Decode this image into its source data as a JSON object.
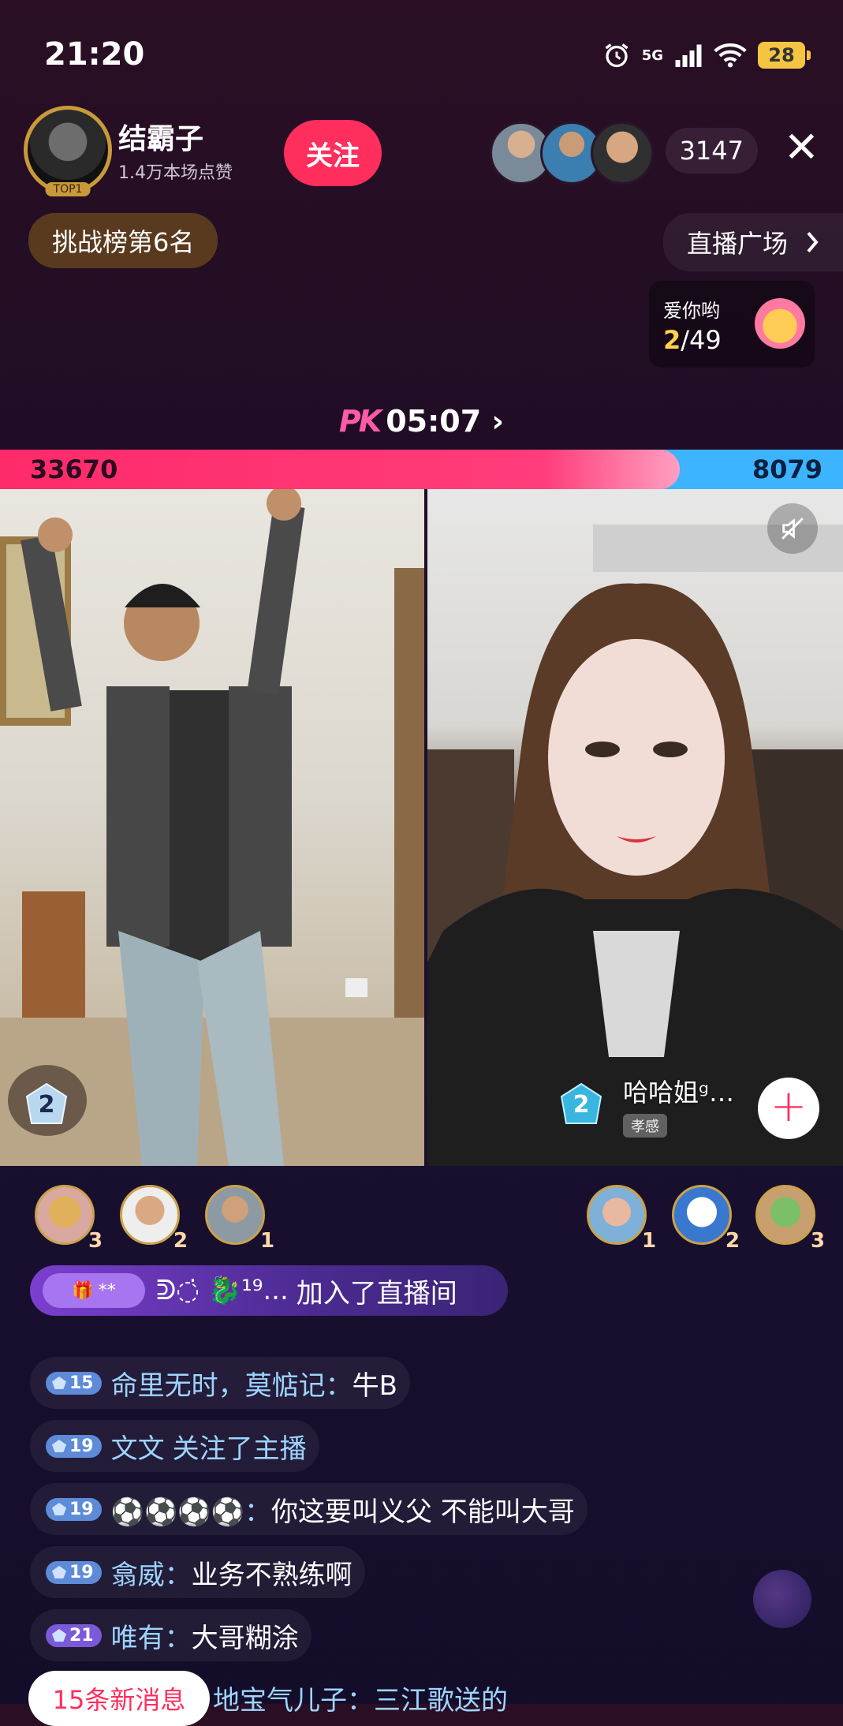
{
  "status_bar": {
    "time": "21:20",
    "network": "5G",
    "battery": "28"
  },
  "host": {
    "name": "结霸子",
    "likes": "1.4万本场点赞",
    "top_badge": "TOP1",
    "follow_label": "关注"
  },
  "viewers": {
    "count": "3147"
  },
  "challenge_rank": "挑战榜第6名",
  "live_plaza": "直播广场",
  "task_card": {
    "title": "爱你哟",
    "current": "2",
    "total": "/49"
  },
  "pk": {
    "label": "PK",
    "timer": "05:07",
    "left_score": "33670",
    "right_score": "8079",
    "left_share": 0.806
  },
  "opponent": {
    "name": "哈哈姐ᵍ…",
    "subtitle": "孝感",
    "level": "2"
  },
  "host_level": "2",
  "fans_left": [
    {
      "rank": "3"
    },
    {
      "rank": "2"
    },
    {
      "rank": "1"
    }
  ],
  "fans_right": [
    {
      "rank": "1"
    },
    {
      "rank": "2"
    },
    {
      "rank": "3"
    }
  ],
  "join_banner": {
    "badge": "**",
    "user": "ᕲ◌̇ 🐉¹⁹...",
    "text": "加入了直播间"
  },
  "chat": [
    {
      "level": "15",
      "user": "命里无时，莫惦记：",
      "message": "牛B",
      "color": "blue"
    },
    {
      "level": "19",
      "user": "文文",
      "message": "关注了主播",
      "color": "blue"
    },
    {
      "level": "19",
      "user": "⚽⚽⚽⚽：",
      "message": "你这要叫义父 不能叫大哥",
      "color": "blue"
    },
    {
      "level": "19",
      "user": "翕威：",
      "message": "业务不熟练啊",
      "color": "blue"
    },
    {
      "level": "21",
      "user": "唯有：",
      "message": "大哥糊涂",
      "color": "purple"
    }
  ],
  "new_messages": "15条新消息",
  "partial_chat": "地宝气儿子：三江歌送的",
  "colors": {
    "accent": "#ff2e5d",
    "score_red": "#ff2a6a",
    "score_blue": "#3cb4ff"
  }
}
